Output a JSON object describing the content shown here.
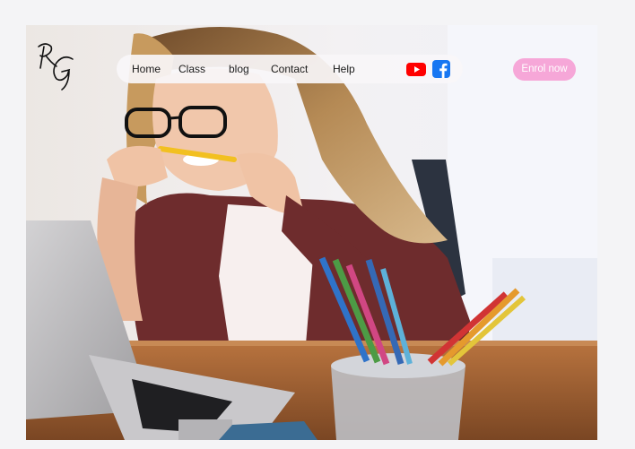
{
  "logo": {
    "letters": "RG"
  },
  "nav": {
    "items": [
      "Home",
      "Class",
      "blog",
      "Contact",
      "Help"
    ]
  },
  "social": {
    "youtube": "youtube-icon",
    "facebook": "facebook-icon"
  },
  "cta": {
    "label": "Enrol now"
  },
  "colors": {
    "page_bg": "#f4f4f6",
    "nav_bg": "#f8f6f8",
    "cta_bg": "#f6a7d8",
    "youtube_red": "#ff0000",
    "facebook_blue": "#1877f2"
  }
}
